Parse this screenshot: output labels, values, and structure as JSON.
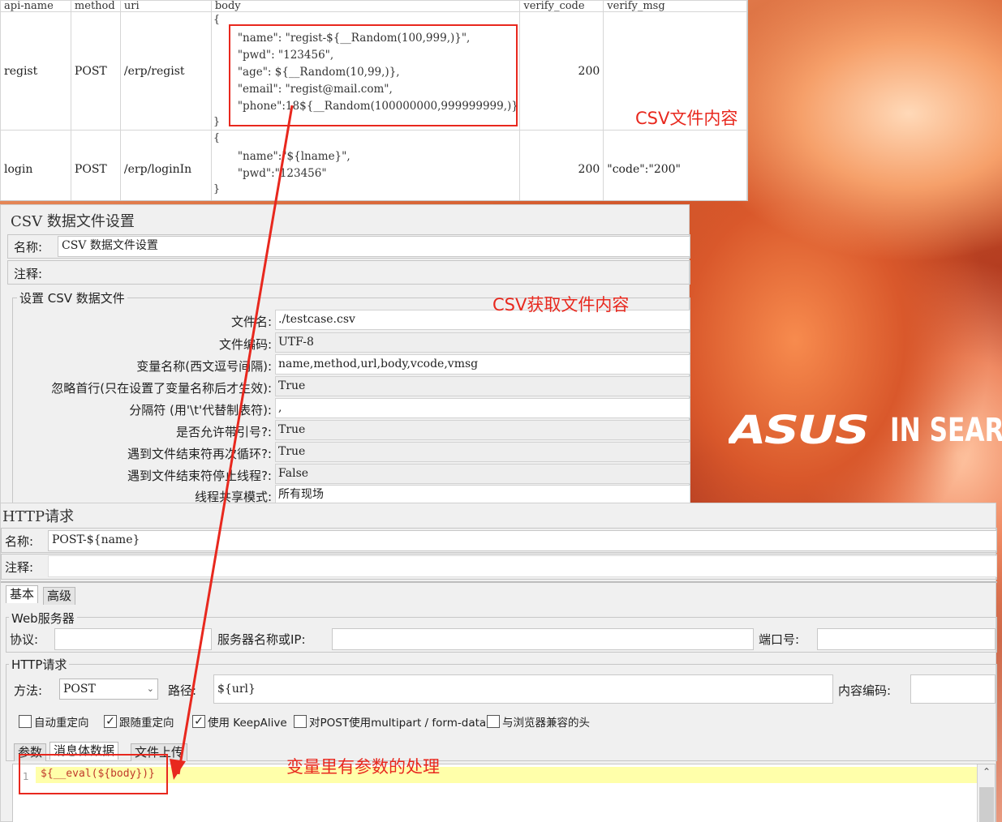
{
  "wallpaper": {
    "brand": "ASUS",
    "slogan": "IN SEAR"
  },
  "csv_table": {
    "headers": [
      "api-name",
      "method",
      "uri",
      "body",
      "verify_code",
      "verify_msg"
    ],
    "rows": [
      {
        "api_name": "regist",
        "method": "POST",
        "uri": "/erp/regist",
        "open_brace": "{",
        "close_brace": "}",
        "body_lines": [
          "\"name\": \"regist-${__Random(100,999,)}\",",
          "\"pwd\": \"123456\",",
          "\"age\": ${__Random(10,99,)},",
          "\"email\": \"regist@mail.com\",",
          "\"phone\":18${__Random(100000000,999999999,)}"
        ],
        "verify_code": "200",
        "verify_msg": ""
      },
      {
        "api_name": "login",
        "method": "POST",
        "uri": "/erp/loginIn",
        "open_brace": "{",
        "close_brace": "}",
        "body_lines": [
          "\"name\":\"${lname}\",",
          "\"pwd\":\"123456\""
        ],
        "verify_code": "200",
        "verify_msg": "\"code\":\"200\""
      }
    ]
  },
  "annotations": {
    "csv_content": "CSV文件内容",
    "csv_read": "CSV获取文件内容",
    "var_param": "变量里有参数的处理"
  },
  "csv_config": {
    "title": "CSV 数据文件设置",
    "name_label": "名称:",
    "name_value": "CSV 数据文件设置",
    "comment_label": "注释:",
    "group_title": "设置 CSV 数据文件",
    "properties": [
      {
        "label": "文件名:",
        "value": "./testcase.csv"
      },
      {
        "label": "文件编码:",
        "value": "UTF-8"
      },
      {
        "label": "变量名称(西文逗号间隔):",
        "value": "name,method,url,body,vcode,vmsg"
      },
      {
        "label": "忽略首行(只在设置了变量名称后才生效):",
        "value": "True"
      },
      {
        "label": "分隔符 (用'\\t'代替制表符):",
        "value": ","
      },
      {
        "label": "是否允许带引号?:",
        "value": "True"
      },
      {
        "label": "遇到文件结束符再次循环?:",
        "value": "True"
      },
      {
        "label": "遇到文件结束符停止线程?:",
        "value": "False"
      },
      {
        "label": "线程共享模式:",
        "value": "所有现场"
      }
    ]
  },
  "http_request": {
    "title": "HTTP请求",
    "name_label": "名称:",
    "name_value": "POST-${name}",
    "comment_label": "注释:",
    "tabs": [
      "基本",
      "高级"
    ],
    "web_server_group": "Web服务器",
    "protocol_label": "协议:",
    "server_label": "服务器名称或IP:",
    "port_label": "端口号:",
    "http_group": "HTTP请求",
    "method_label": "方法:",
    "method_value": "POST",
    "path_label": "路径:",
    "path_value": "${url}",
    "encoding_label": "内容编码:",
    "checkboxes": [
      {
        "label": "自动重定向",
        "checked": false
      },
      {
        "label": "跟随重定向",
        "checked": true
      },
      {
        "label": "使用 KeepAlive",
        "checked": true
      },
      {
        "label": "对POST使用multipart / form-data",
        "checked": false
      },
      {
        "label": "与浏览器兼容的头",
        "checked": false
      }
    ],
    "sub_tabs": [
      "参数",
      "消息体数据",
      "文件上传"
    ],
    "line_number": "1",
    "body_code": "${__eval(${body})}"
  },
  "colors": {
    "annotation_red": "#e8281e",
    "highlight_line": "#ffffaa"
  }
}
